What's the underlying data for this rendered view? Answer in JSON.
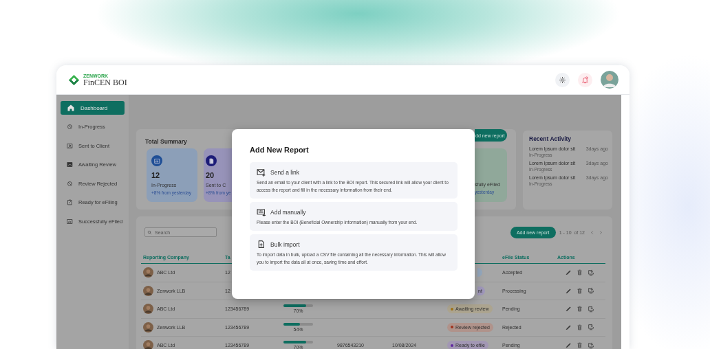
{
  "header": {
    "brand_top": "ZENWORK",
    "brand": "FinCEN BOI"
  },
  "sidebar": {
    "items": [
      {
        "label": "Dashboard",
        "selected": true
      },
      {
        "label": "In-Progress",
        "selected": false
      },
      {
        "label": "Sent to Client",
        "selected": false
      },
      {
        "label": "Awaiting Review",
        "selected": false
      },
      {
        "label": "Review Rejected",
        "selected": false
      },
      {
        "label": "Ready for eFiling",
        "selected": false
      },
      {
        "label": "Successfully eFiled",
        "selected": false
      }
    ]
  },
  "summary": {
    "title": "Total Summary",
    "button": "dd new report",
    "cards": [
      {
        "kind": "full",
        "value": "12",
        "label": "In-Progress",
        "delta": "+8% from yesterday",
        "color": "#8c9fb8"
      },
      {
        "kind": "cut_right",
        "value": "20",
        "label": "Sent to C",
        "delta": "+8% from ye",
        "color": "#9793b9"
      },
      {
        "kind": "cut_left",
        "label": "sfully eFiled",
        "delta": "yesterday",
        "color": "#90a89a"
      }
    ]
  },
  "recent_activity": {
    "title": "Recent Activity",
    "items": [
      {
        "title": "Lorem Ipsum dolor sit",
        "time": "3days ago",
        "status": "In-Progress"
      },
      {
        "title": "Lorem Ipsum dolor sit",
        "time": "3days ago",
        "status": "In-Progress"
      },
      {
        "title": "Lorem Ipsum dolor sit",
        "time": "3days ago",
        "status": "In-Progress"
      }
    ]
  },
  "reports": {
    "search": {
      "placeholder": "Search"
    },
    "add_button": "Add new report",
    "pagination": "1 - 10  of 12",
    "columns": {
      "company": "Reporting Company",
      "column_2": "Ta",
      "efile_status": "eFile Status",
      "actions": "Actions"
    },
    "rows": [
      {
        "company": "ABC Ltd",
        "column_2": "12",
        "status": {
          "kind": "fragment",
          "color": "#93a7bd"
        },
        "efile_status": "Accepted"
      },
      {
        "company": "Zenwork LLB",
        "column_2": "12",
        "status": {
          "kind": "fragment",
          "label": "nt",
          "color": "#9f97ba"
        },
        "efile_status": "Processing"
      },
      {
        "company": "ABC Ltd",
        "column_2": "123456789",
        "progress": {
          "level": 0.77,
          "reading": "70%"
        },
        "status": {
          "kind": "pill",
          "label": "Awaiting review",
          "color": "#a07418"
        },
        "efile_status": "Pending"
      },
      {
        "company": "Zenwork LLB",
        "column_2": "123456789",
        "progress": {
          "level": 0.55,
          "reading": "54%"
        },
        "status": {
          "kind": "pill",
          "label": "Review rejected",
          "color": "#a0331d"
        },
        "efile_status": "Rejected"
      },
      {
        "company": "ABC Ltd",
        "column_2": "123456789",
        "progress": {
          "level": 0.77,
          "reading": "70%"
        },
        "column_4": "9876543210",
        "column_5": "10/08/2024",
        "status": {
          "kind": "pill",
          "label": "Ready to efile",
          "color": "#6128a0"
        },
        "efile_status": "Pending"
      }
    ]
  },
  "modal": {
    "title": "Add New Report",
    "options": [
      {
        "title": "Send a link",
        "text": "Send an email to your client with a link to the BOI report. This secured link will allow your client to access the report and fill in the necessary information from their end."
      },
      {
        "title": "Add manually",
        "text": "Please enter the BOI (Beneficial Ownership Information) manually from your end."
      },
      {
        "title": "Bulk import",
        "text": "To import data in bulk, upload a CSV file containing all the necessary information. This will allow you to import the data all at once, saving time and effort."
      }
    ]
  }
}
